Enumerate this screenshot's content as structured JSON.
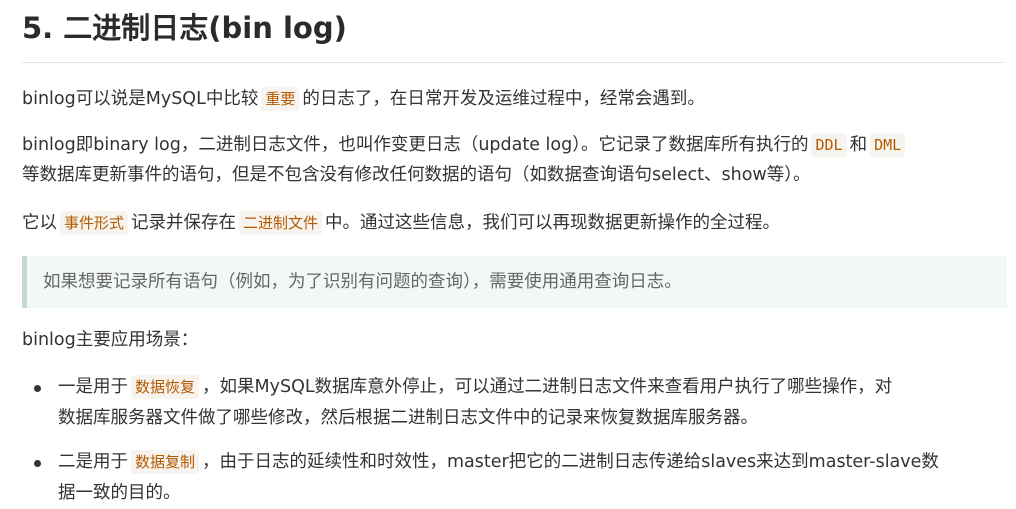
{
  "heading": "5. 二进制日志(bin log)",
  "p1": {
    "a": "binlog可以说是MySQL中比较",
    "code": "重要",
    "b": "的日志了，在日常开发及运维过程中，经常会遇到。"
  },
  "p2": {
    "a": "binlog即binary log，二进制日志文件，也叫作变更日志（update log）。它记录了数据库所有执行的",
    "code1": "DDL",
    "b": "和",
    "code2": "DML",
    "line2": "等数据库更新事件的语句，但是不包含没有修改任何数据的语句（如数据查询语句select、show等）。"
  },
  "p3": {
    "a": "它以",
    "code1": "事件形式",
    "b": "记录并保存在",
    "code2": "二进制文件",
    "c": "中。通过这些信息，我们可以再现数据更新操作的全过程。"
  },
  "quote": "如果想要记录所有语句（例如，为了识别有问题的查询），需要使用通用查询日志。",
  "p4": "binlog主要应用场景：",
  "list": [
    {
      "a": "一是用于",
      "code": "数据恢复",
      "b": "，如果MySQL数据库意外停止，可以通过二进制日志文件来查看用户执行了哪些操作，对",
      "line2": "数据库服务器文件做了哪些修改，然后根据二进制日志文件中的记录来恢复数据库服务器。"
    },
    {
      "a": "二是用于",
      "code": "数据复制",
      "b": "，由于日志的延续性和时效性，master把它的二进制日志传递给slaves来达到master-slave数",
      "line2": "据一致的目的。"
    }
  ]
}
